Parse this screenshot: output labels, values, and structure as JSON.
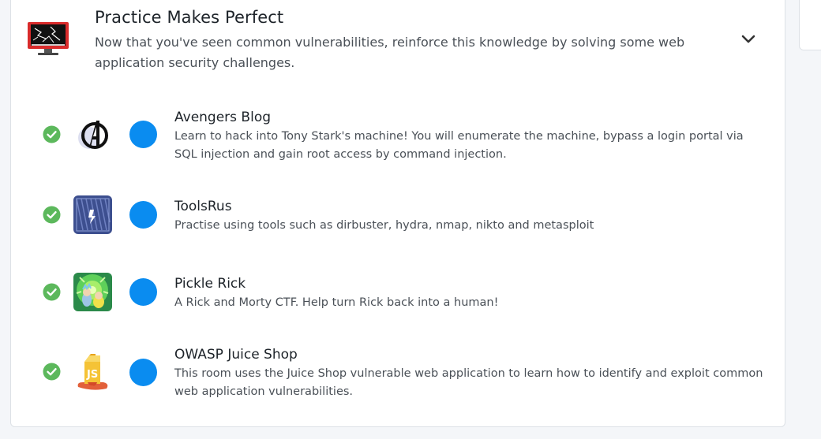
{
  "module": {
    "title": "Practice Makes Perfect",
    "description": "Now that you've seen common vulnerabilities, reinforce this knowledge by solving some web application security challenges.",
    "icon": "monitor-glitch-icon",
    "expand_icon": "chevron-down-icon"
  },
  "colors": {
    "check_green": "#5cb85c",
    "dot_blue": "#0a8cf0",
    "title_text": "#1d2329",
    "desc_text": "#4a5057"
  },
  "rooms": [
    {
      "title": "Avengers Blog",
      "description": "Learn to hack into Tony Stark's machine! You will enumerate the machine, bypass a login portal via SQL injection and gain root access by command injection.",
      "completed": true,
      "thumbnail": "avengers-logo-icon"
    },
    {
      "title": "ToolsRus",
      "description": "Practise using tools such as dirbuster, hydra, nmap, nikto and metasploit",
      "completed": true,
      "thumbnail": "toolsrus-logo-icon"
    },
    {
      "title": "Pickle Rick",
      "description": "A Rick and Morty CTF. Help turn Rick back into a human!",
      "completed": true,
      "thumbnail": "pickle-rick-icon"
    },
    {
      "title": "OWASP Juice Shop",
      "description": "This room uses the Juice Shop vulnerable web application to learn how to identify and exploit common web application vulnerabilities.",
      "completed": true,
      "thumbnail": "juice-shop-icon"
    }
  ]
}
